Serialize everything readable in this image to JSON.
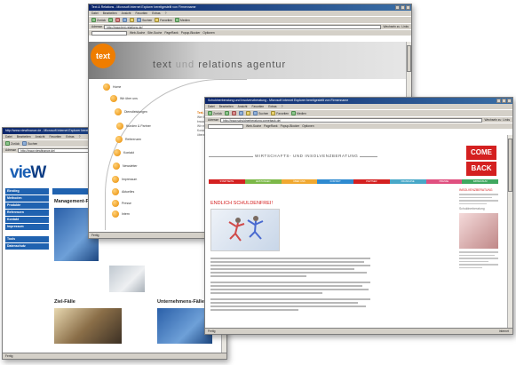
{
  "browser": {
    "menu": [
      "Datei",
      "Bearbeiten",
      "Ansicht",
      "Favoriten",
      "Extras",
      "?"
    ],
    "toolbar": {
      "back": "Zurück",
      "search": "Suchen",
      "favorites": "Favoriten",
      "media": "Medien"
    },
    "address_label": "Adresse",
    "go_label": "Wechseln zu",
    "links_label": "Links",
    "links_labels": [
      "Web-Suche",
      "Site-Suche",
      "PageRank",
      "Popup-Blocker",
      "Optionen"
    ]
  },
  "win1": {
    "title": "http://www.viewfinance.de - Microsoft Internet Explorer bereitgestellt von Firmenname",
    "url": "http://www.viewfinance.de/",
    "logo": {
      "main": "vie",
      "accent": "W"
    },
    "nav": [
      "Einstieg",
      "Methoden",
      "Produkte",
      "Referenzen",
      "Kontakt",
      "Impressum",
      "Tools",
      "Datenschutz"
    ],
    "tab": "Übersicht",
    "headings": [
      "Management-Fälle",
      "Ziel-Fälle",
      "Unternehmens-Fälle"
    ],
    "status": "Fertig"
  },
  "win2": {
    "title": "Text & Relations - Microsoft Internet Explorer bereitgestellt von Firmenname",
    "url": "http://www.text-relations.de/",
    "logo": "text",
    "tagline": {
      "a": "text",
      "b": "und",
      "c": "relations",
      "d": "agentur"
    },
    "menu": [
      "Home",
      "Wir über uns",
      "Dienstleistungen",
      "Kunden & Partner",
      "Referenzen",
      "Kontakt",
      "Newsletter",
      "Impressum",
      "Aktuelles",
      "Presse",
      "Intern"
    ],
    "side_title": "Text, Idee ...",
    "side_text": "Wer Botschaften vermitteln will, braucht die richtigen Worte. Wir entwickeln Texte und Konzepte, die ankommen und überzeugen.",
    "status": "Fertig"
  },
  "win3": {
    "title": "Schuldnerberatung und Insolvenzberatung - Microsoft Internet Explorer bereitgestellt von Firmenname",
    "url": "http://www.schuldnerberatung-comeback.de/",
    "header": "WIRTSCHAFTS- UND INSOLVENZBERATUNG",
    "logo_top": "COME",
    "logo_bottom": "BACK",
    "nav": [
      {
        "label": "STARTSEITE",
        "color": "#d42020"
      },
      {
        "label": "LEISTUNGEN",
        "color": "#7cb848"
      },
      {
        "label": "ÜBER UNS",
        "color": "#f0a830"
      },
      {
        "label": "KONTAKT",
        "color": "#2e8ad0"
      },
      {
        "label": "PARTNER",
        "color": "#d42020"
      },
      {
        "label": "FRANCHISE",
        "color": "#48a8c8"
      },
      {
        "label": "PRESSE",
        "color": "#e05080"
      },
      {
        "label": "IMPRESSUM",
        "color": "#40a860"
      }
    ],
    "main_title": "ENDLICH SCHULDENFREI!",
    "side_title_1": "INSOLVENZBERATUNG",
    "side_title_2": "Schuldnerberatung",
    "status": "Fertig",
    "zone": "Internet"
  },
  "colors": {
    "titlebar": "#0a246a",
    "chrome": "#d4d0c8",
    "view_blue": "#1f62b0",
    "text_orange": "#ef7d00",
    "comeback_red": "#d42020"
  }
}
